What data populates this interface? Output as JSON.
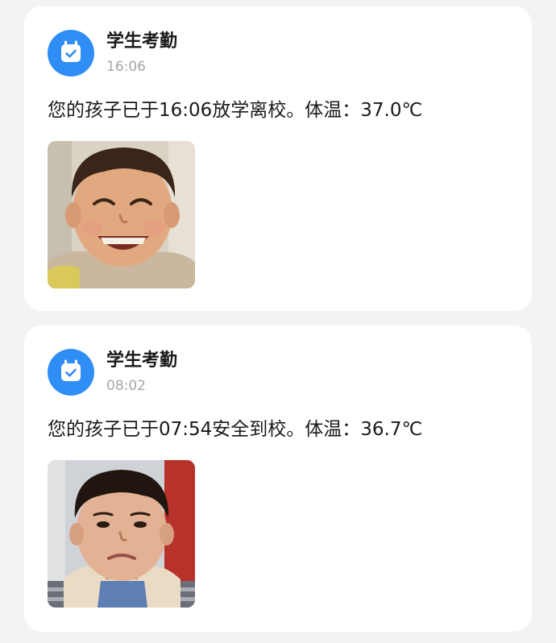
{
  "colors": {
    "page_background": "#f2f3f5",
    "card_background": "#ffffff",
    "accent": "#2f8ef5",
    "primary_text": "#1a1a1a",
    "secondary_text": "#a6a6a6"
  },
  "messages": [
    {
      "app_name": "学生考勤",
      "app_icon": "calendar-check-icon",
      "time": "16:06",
      "text": "您的孩子已于16:06放学离校。体温：37.0℃",
      "photo": "student-face-photo-smiling"
    },
    {
      "app_name": "学生考勤",
      "app_icon": "calendar-check-icon",
      "time": "08:02",
      "text": "您的孩子已于07:54安全到校。体温：36.7℃",
      "photo": "student-face-photo-frowning"
    }
  ]
}
